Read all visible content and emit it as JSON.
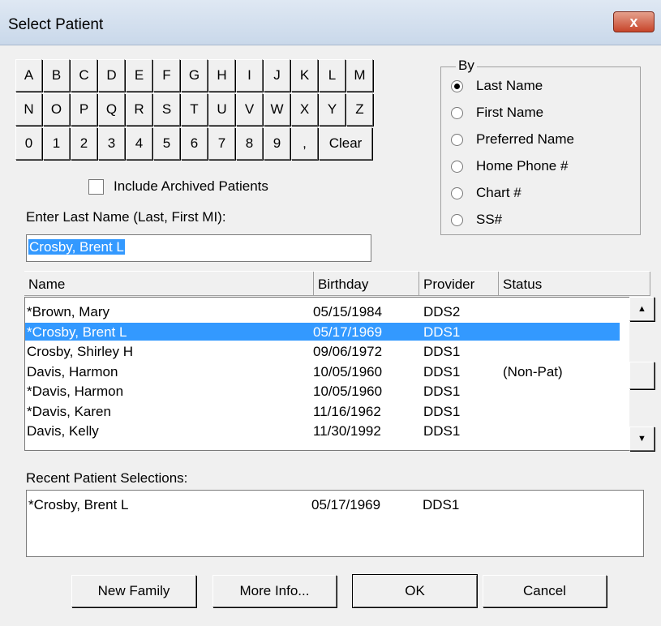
{
  "window": {
    "title": "Select Patient",
    "close_label": "x"
  },
  "keypad": {
    "row1": [
      "A",
      "B",
      "C",
      "D",
      "E",
      "F",
      "G",
      "H",
      "I",
      "J",
      "K",
      "L",
      "M"
    ],
    "row2": [
      "N",
      "O",
      "P",
      "Q",
      "R",
      "S",
      "T",
      "U",
      "V",
      "W",
      "X",
      "Y",
      "Z"
    ],
    "row3": [
      "0",
      "1",
      "2",
      "3",
      "4",
      "5",
      "6",
      "7",
      "8",
      "9",
      ","
    ],
    "clear_label": "Clear"
  },
  "archived": {
    "label": "Include Archived Patients",
    "checked": false
  },
  "by": {
    "legend": "By",
    "options": [
      "Last Name",
      "First Name",
      "Preferred Name",
      "Home Phone #",
      "Chart #",
      "SS#"
    ],
    "selected": "Last Name"
  },
  "search": {
    "label": "Enter Last Name (Last, First MI):",
    "value": "Crosby, Brent L"
  },
  "list": {
    "headers": {
      "name": "Name",
      "birthday": "Birthday",
      "provider": "Provider",
      "status": "Status"
    },
    "rows": [
      {
        "name": "*Brown, Mary",
        "birthday": "05/15/1984",
        "provider": "DDS2",
        "status": ""
      },
      {
        "name": "*Crosby, Brent L",
        "birthday": "05/17/1969",
        "provider": "DDS1",
        "status": ""
      },
      {
        "name": " Crosby, Shirley H",
        "birthday": "09/06/1972",
        "provider": "DDS1",
        "status": ""
      },
      {
        "name": " Davis, Harmon",
        "birthday": "10/05/1960",
        "provider": "DDS1",
        "status": "(Non-Pat)"
      },
      {
        "name": "*Davis, Harmon",
        "birthday": "10/05/1960",
        "provider": "DDS1",
        "status": ""
      },
      {
        "name": "*Davis, Karen",
        "birthday": "11/16/1962",
        "provider": "DDS1",
        "status": ""
      },
      {
        "name": " Davis, Kelly",
        "birthday": "11/30/1992",
        "provider": "DDS1",
        "status": ""
      }
    ],
    "selected_index": 1
  },
  "recent": {
    "label": "Recent Patient Selections:",
    "rows": [
      {
        "name": "*Crosby, Brent L",
        "birthday": "05/17/1969",
        "provider": "DDS1"
      }
    ]
  },
  "buttons": {
    "new_family": "New Family",
    "more_info": "More Info...",
    "ok": "OK",
    "cancel": "Cancel"
  },
  "colors": {
    "selection": "#3399ff",
    "close_button": "#c7452b"
  }
}
